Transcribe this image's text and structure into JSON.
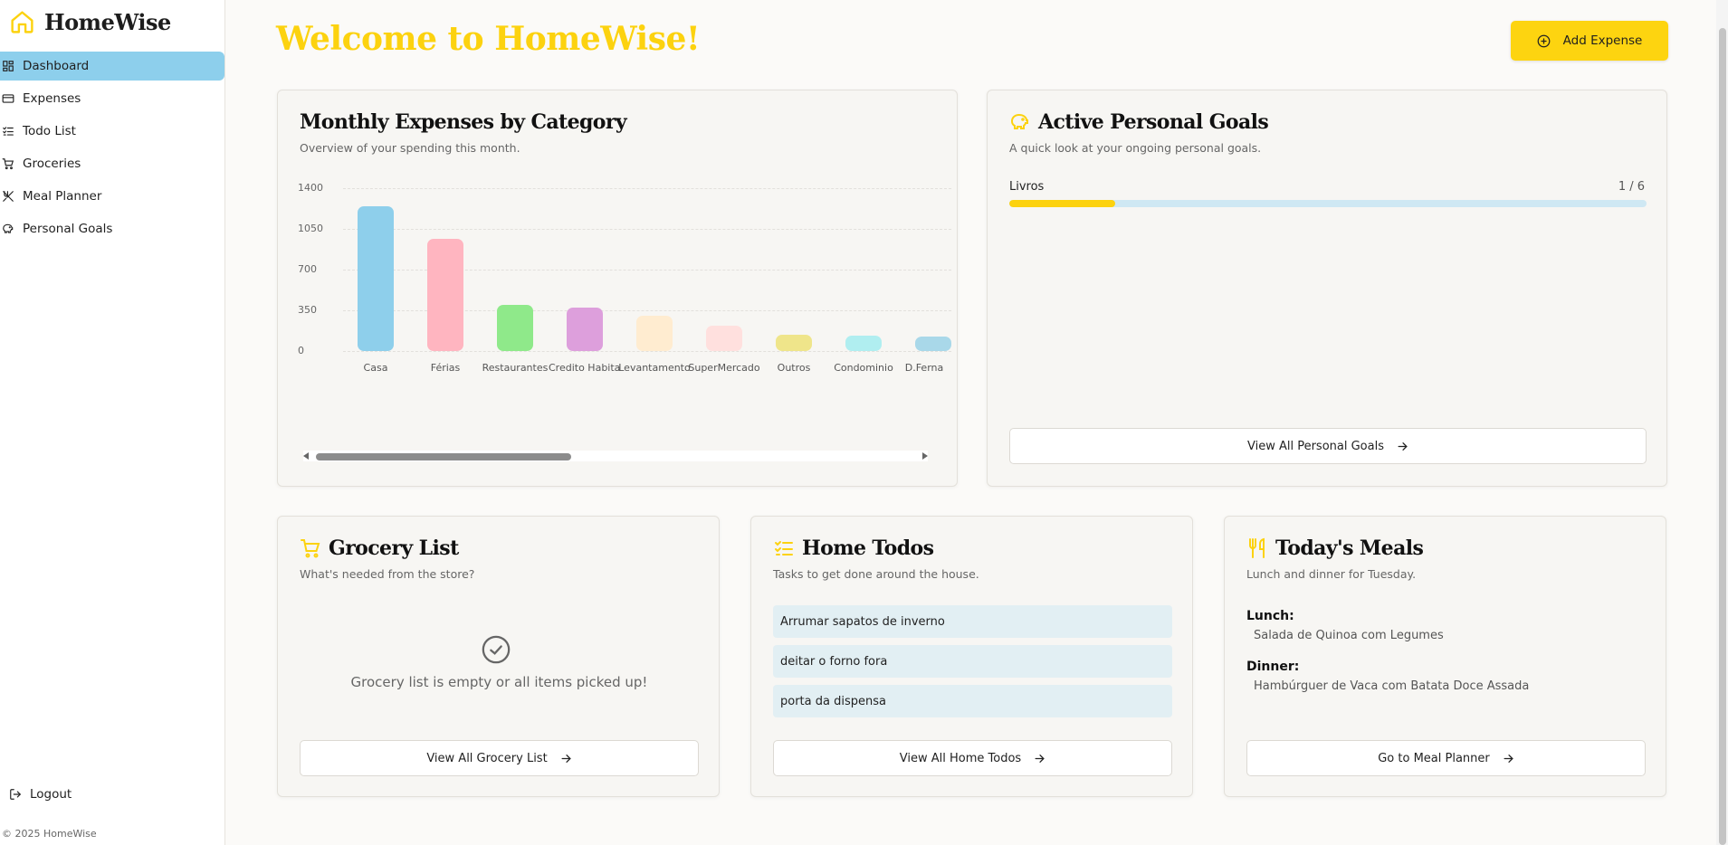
{
  "app": {
    "name": "HomeWise"
  },
  "sidebar": {
    "items": [
      {
        "label": "Dashboard",
        "icon": "dashboard-icon",
        "active": true
      },
      {
        "label": "Expenses",
        "icon": "credit-card-icon"
      },
      {
        "label": "Todo List",
        "icon": "list-checks-icon"
      },
      {
        "label": "Groceries",
        "icon": "shopping-cart-icon"
      },
      {
        "label": "Meal Planner",
        "icon": "utensils-crossed-icon"
      },
      {
        "label": "Personal Goals",
        "icon": "piggy-bank-icon"
      }
    ],
    "logout_label": "Logout",
    "copyright": "© 2025 HomeWise"
  },
  "header": {
    "welcome": "Welcome to HomeWise!",
    "add_expense_label": "Add Expense"
  },
  "colors": {
    "accent": "#fcd20f",
    "active_nav": "#8dcfec"
  },
  "expenses_card": {
    "title": "Monthly Expenses by Category",
    "subtitle": "Overview of your spending this month."
  },
  "chart_data": {
    "type": "bar",
    "categories": [
      "Casa",
      "Férias",
      "Restaurantes",
      "Credito Habitaç...",
      "Levantamento",
      "SuperMercado",
      "Outros",
      "Condominio",
      "D.Ferna"
    ],
    "values": [
      1245,
      965,
      400,
      370,
      300,
      215,
      140,
      135,
      125
    ],
    "colors": [
      "#8ecfeb",
      "#ffb5c0",
      "#8fe98a",
      "#dd9fdc",
      "#ffecd0",
      "#ffe0de",
      "#efe58a",
      "#b0eef0",
      "#a9d8e9"
    ],
    "y_ticks": [
      "1400",
      "1050",
      "700",
      "350",
      "0"
    ],
    "ylim": [
      0,
      1400
    ],
    "grid": true
  },
  "goals_card": {
    "title": "Active Personal Goals",
    "subtitle": "A quick look at your ongoing personal goals.",
    "goals": [
      {
        "name": "Livros",
        "count": "1 / 6",
        "progress": 0.1667
      }
    ],
    "view_all_label": "View All Personal Goals"
  },
  "grocery_card": {
    "title": "Grocery List",
    "subtitle": "What's needed from the store?",
    "empty_message": "Grocery list is empty or all items picked up!",
    "view_all_label": "View All Grocery List"
  },
  "todos_card": {
    "title": "Home Todos",
    "subtitle": "Tasks to get done around the house.",
    "items": [
      "Arrumar sapatos de inverno",
      "deitar o forno fora",
      "porta da dispensa"
    ],
    "view_all_label": "View All Home Todos"
  },
  "meals_card": {
    "title": "Today's Meals",
    "subtitle": "Lunch and dinner for Tuesday.",
    "lunch_label": "Lunch:",
    "lunch_value": "Salada de Quinoa com Legumes",
    "dinner_label": "Dinner:",
    "dinner_value": "Hambúrguer de Vaca com Batata Doce Assada",
    "go_label": "Go to Meal Planner"
  }
}
